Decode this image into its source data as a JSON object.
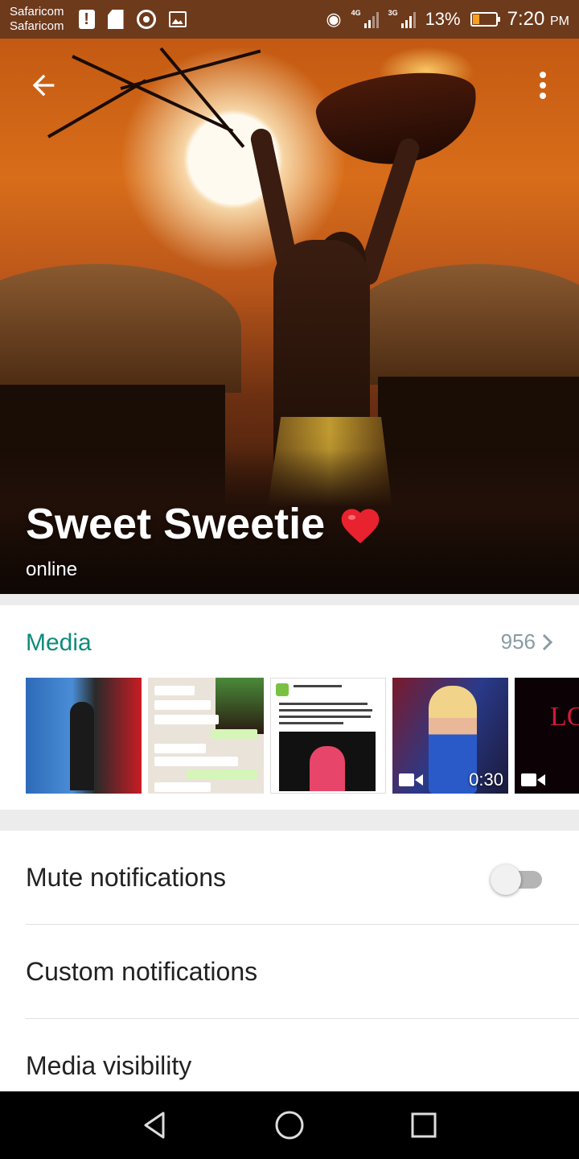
{
  "status_bar": {
    "carriers": [
      "Safaricom",
      "Safaricom"
    ],
    "network1": "4G",
    "network2": "3G",
    "battery_percent": "13%",
    "time": "7:20",
    "time_suffix": "PM"
  },
  "header": {
    "contact_name": "Sweet Sweetie",
    "status": "online",
    "back_icon": "arrow-left-icon",
    "menu_icon": "more-vertical-icon"
  },
  "media": {
    "title": "Media",
    "count": "956",
    "thumbnails": [
      {
        "type": "image"
      },
      {
        "type": "image"
      },
      {
        "type": "image",
        "caption": "Citizen TV Kenya"
      },
      {
        "type": "video",
        "duration": "0:30"
      },
      {
        "type": "video",
        "caption": "LOV"
      }
    ]
  },
  "settings": {
    "mute_notifications": {
      "label": "Mute notifications",
      "enabled": false
    },
    "custom_notifications": {
      "label": "Custom notifications"
    },
    "media_visibility": {
      "label": "Media visibility"
    }
  },
  "colors": {
    "accent": "#0f8b7a",
    "status_bar": "#6e3a1c",
    "navbar": "#000000"
  }
}
